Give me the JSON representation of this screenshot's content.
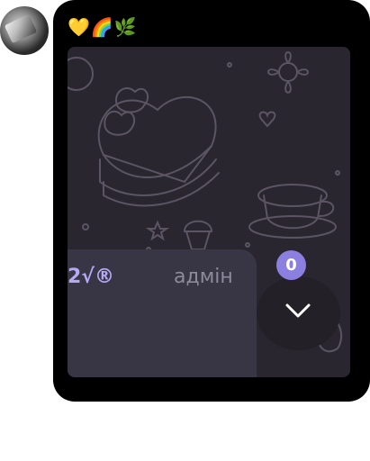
{
  "message": {
    "reactions": "💛🌈🌿",
    "preview_text": "2√®",
    "sender_role": "адмін"
  },
  "unread_badge": {
    "count": "0"
  },
  "icons": {
    "avatar": "user-avatar",
    "scroll_down": "chevron-down-icon"
  },
  "colors": {
    "bubble": "#000000",
    "media_bg": "#2a262f",
    "card_bg": "#383545",
    "accent_text": "#b7a8f4",
    "badge": "#8b7fe0"
  }
}
